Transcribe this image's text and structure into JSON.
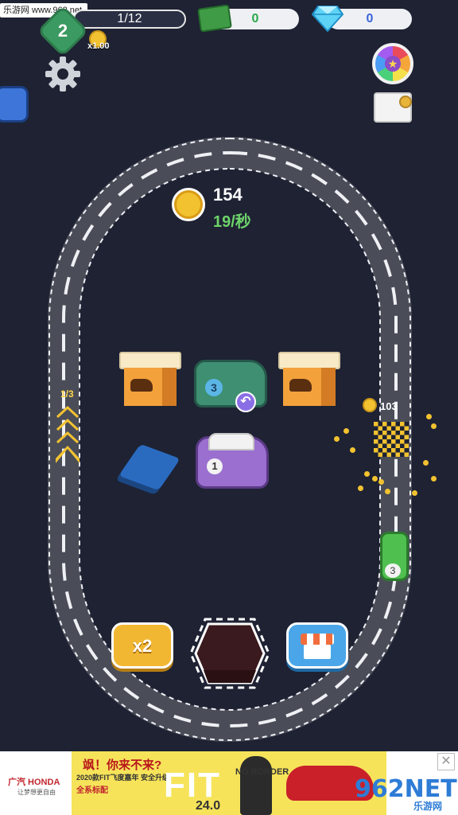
{
  "watermark": {
    "site": "乐游网 www.962.net",
    "logo": "962NET",
    "logo_cn": "乐游网"
  },
  "hud": {
    "level": "2",
    "progress": "1/12",
    "income_multiplier": "x1.00",
    "cash": "0",
    "gems": "0"
  },
  "coins": {
    "total": "154",
    "rate": "19/秒",
    "side_count": "103"
  },
  "lap": {
    "label": "1/3"
  },
  "slots": [
    {
      "type": "crate"
    },
    {
      "type": "car",
      "level": "3",
      "color": "#3f8f73"
    },
    {
      "type": "crate"
    },
    {
      "type": "empty-pad",
      "color": "#2a6bc0"
    },
    {
      "type": "car",
      "level": "1",
      "color": "#9a6fcf"
    }
  ],
  "racing_car": {
    "level": "3",
    "color": "#4fbf50"
  },
  "buttons": {
    "x2_label": "x2"
  },
  "colors": {
    "background": "#1e2233",
    "coin": "#f2c230",
    "rate": "#6ed36a"
  },
  "ad": {
    "brand": "广汽 HONDA",
    "brand_sub": "让梦想更自由",
    "headline": "飒！你来不来?",
    "sub": "2020款FIT飞度嘉年 安全升级",
    "red": "全系标配",
    "model": "FIT",
    "price": "24.0",
    "tag": "NO BORDER"
  }
}
